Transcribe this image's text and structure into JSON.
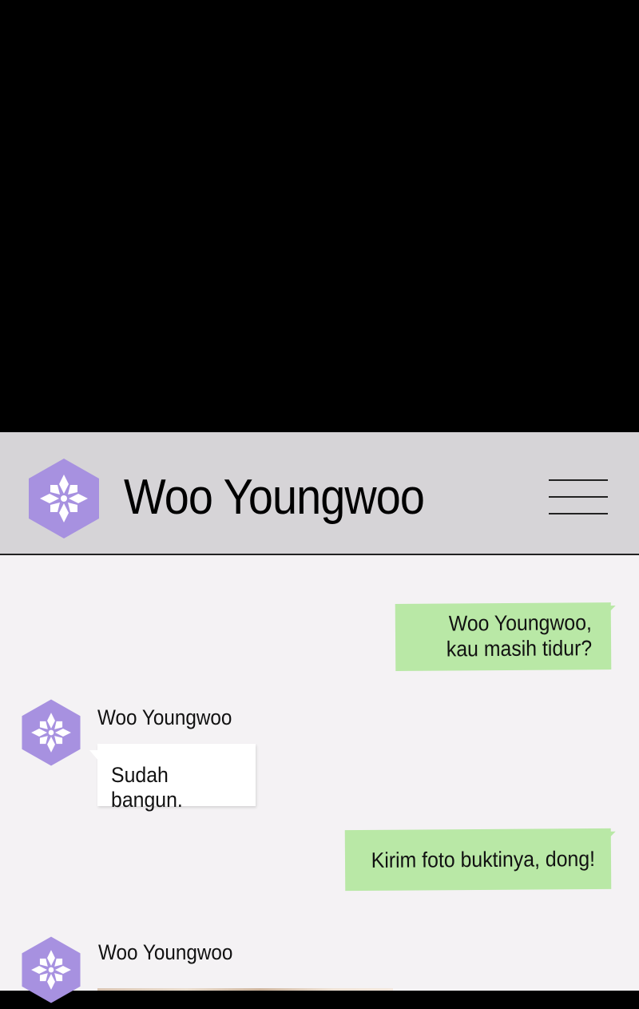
{
  "header": {
    "contact_name": "Woo Youngwoo",
    "avatar_icon": "flower-hexagon-icon",
    "menu_icon": "hamburger-menu-icon"
  },
  "messages": [
    {
      "direction": "outgoing",
      "text": "Woo Youngwoo,\nkau masih tidur?"
    },
    {
      "direction": "incoming",
      "sender": "Woo Youngwoo",
      "text": "Sudah bangun."
    },
    {
      "direction": "outgoing",
      "text": "Kirim foto buktinya, dong!"
    },
    {
      "direction": "incoming",
      "sender": "Woo Youngwoo",
      "type": "photo"
    }
  ],
  "colors": {
    "header_bg": "#d6d4d7",
    "chat_bg": "#f4f2f4",
    "outgoing_bubble": "#b9e8a6",
    "incoming_bubble": "#ffffff",
    "avatar_purple": "#a791e0"
  }
}
